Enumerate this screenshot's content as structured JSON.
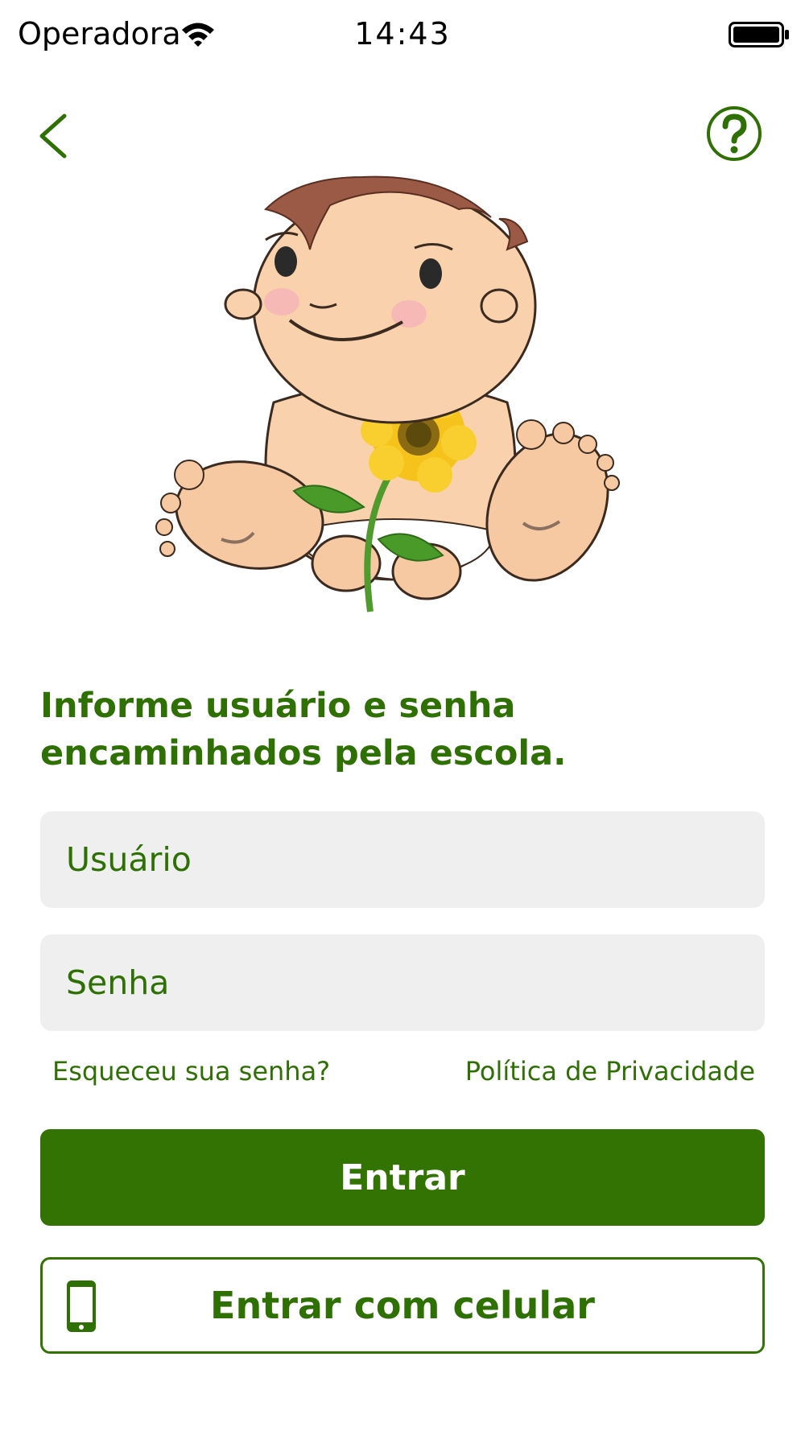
{
  "status_bar": {
    "carrier": "Operadora",
    "time": "14:43",
    "icons": [
      "wifi-icon",
      "battery-icon"
    ]
  },
  "nav": {
    "back_icon": "chevron-left-icon",
    "help_icon": "question-circle-icon"
  },
  "hero": {
    "image": "baby-with-sunflower-illustration"
  },
  "instruction": "Informe usuário e senha encaminhados pela escola.",
  "form": {
    "user_placeholder": "Usuário",
    "user_value": "",
    "password_placeholder": "Senha",
    "password_value": ""
  },
  "links": {
    "forgot": "Esqueceu sua senha?",
    "privacy": "Política de Privacidade"
  },
  "buttons": {
    "login": "Entrar",
    "login_phone": "Entrar com celular",
    "login_phone_icon": "mobile-phone-icon"
  },
  "colors": {
    "brand_green": "#337304",
    "text_green": "#2f7004",
    "field_bg": "#efefef"
  }
}
